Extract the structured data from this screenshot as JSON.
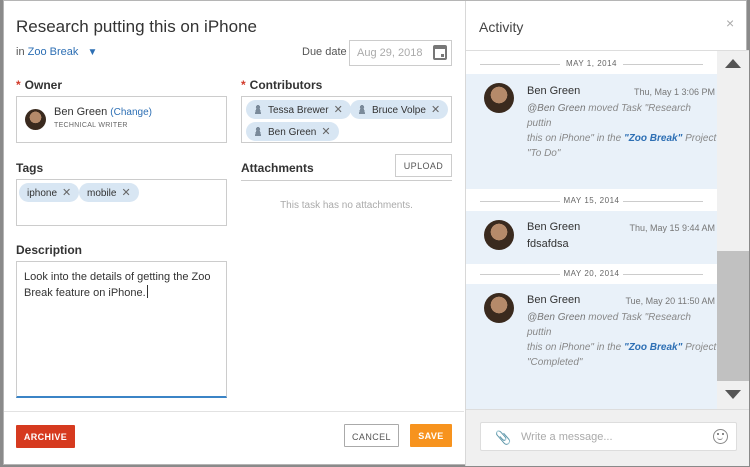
{
  "task": {
    "title": "Research putting this on iPhone",
    "in_prefix": "in",
    "project": "Zoo Break",
    "due_label": "Due date",
    "due_placeholder": "Aug 29, 2018"
  },
  "owner": {
    "label": "Owner",
    "name": "Ben Green",
    "change": "(Change)",
    "role": "TECHNICAL WRITER"
  },
  "contributors": {
    "label": "Contributors",
    "items": [
      "Tessa Brewer",
      "Bruce Volpe",
      "Ben Green"
    ]
  },
  "tags": {
    "label": "Tags",
    "items": [
      "iphone",
      "mobile"
    ]
  },
  "attachments": {
    "label": "Attachments",
    "upload": "UPLOAD",
    "empty": "This task has no attachments."
  },
  "description": {
    "label": "Description",
    "text": "Look into the details of getting the Zoo Break feature on iPhone."
  },
  "footer": {
    "archive": "ARCHIVE",
    "cancel": "CANCEL",
    "save": "SAVE"
  },
  "activity": {
    "title": "Activity",
    "close": "×",
    "groups": [
      {
        "date": "MAY 1, 2014",
        "name": "Ben Green",
        "time": "Thu, May 1 3:06 PM",
        "line1_user": "@Ben Green",
        "line1_text": " moved Task \"Research puttin",
        "line2_text": "this on iPhone\" in the ",
        "line2_proj": "\"Zoo Break\"",
        "line2_tail": " Project",
        "line3_text": "\"To Do\""
      },
      {
        "date": "MAY 15, 2014",
        "name": "Ben Green",
        "time": "Thu, May 15 9:44 AM",
        "message": "fdsafdsa"
      },
      {
        "date": "MAY 20, 2014",
        "name": "Ben Green",
        "time": "Tue, May 20 11:50 AM",
        "line1_user": "@Ben Green",
        "line1_text": " moved Task \"Research puttin",
        "line2_text": "this on iPhone\" in the ",
        "line2_proj": "\"Zoo Break\"",
        "line2_tail": " Project",
        "line3_text": "\"Completed\""
      }
    ],
    "message_placeholder": "Write a message..."
  },
  "icons": {
    "paperclip": "📎",
    "chevron": "⌄",
    "remove": "✕"
  },
  "colors": {
    "accent": "#2d6fb4",
    "archive": "#d63a1f",
    "save": "#f7931e",
    "chip": "#d8e6f3",
    "activity_bg": "#e9f1f9"
  }
}
